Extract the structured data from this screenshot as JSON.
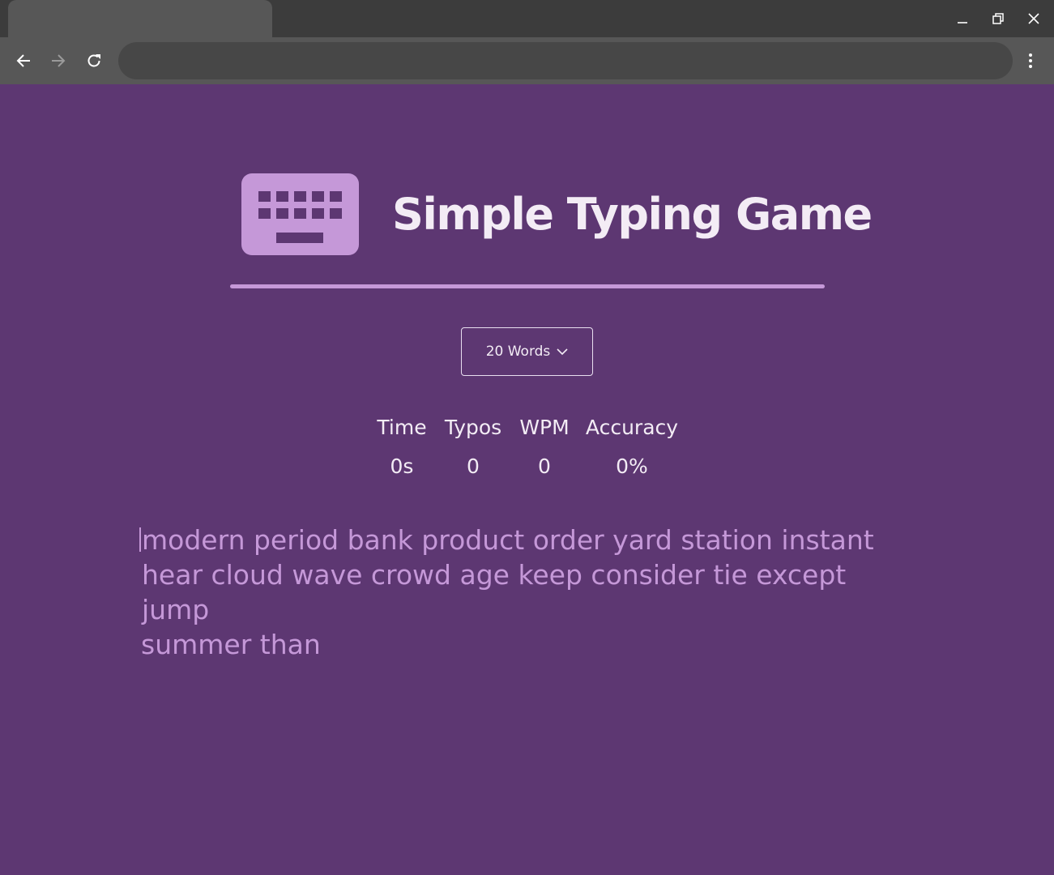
{
  "browser": {
    "address_value": "",
    "icons": {
      "back": "arrow-left-icon",
      "forward": "arrow-right-icon",
      "reload": "reload-icon",
      "menu": "kebab-menu-icon",
      "minimize": "minimize-icon",
      "restore": "restore-icon",
      "close": "close-icon"
    }
  },
  "app": {
    "title": "Simple Typing Game",
    "icon": "keyboard-icon",
    "word_count_select": {
      "selected": "20 Words",
      "icon": "chevron-down-icon"
    },
    "stats": [
      {
        "label": "Time",
        "value": "0s"
      },
      {
        "label": "Typos",
        "value": "0"
      },
      {
        "label": "WPM",
        "value": "0"
      },
      {
        "label": "Accuracy",
        "value": "0%"
      }
    ],
    "text_lines": [
      "modern period bank product order yard station instant",
      "hear cloud wave crowd age keep consider tie except jump",
      "summer than"
    ]
  },
  "colors": {
    "background": "#5d3772",
    "accent": "#c598d8",
    "text": "#f3ecf5",
    "chrome_dark": "#3c3c3c",
    "chrome_light": "#575757"
  }
}
